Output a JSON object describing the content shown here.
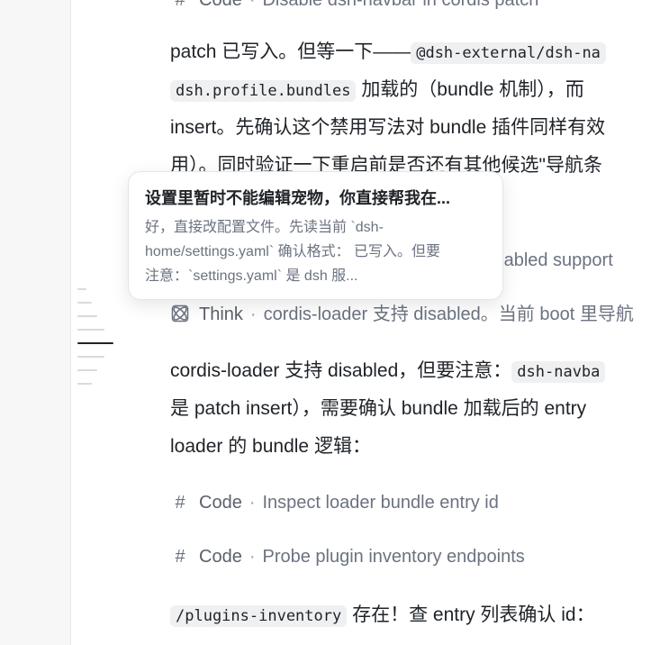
{
  "top_step": {
    "kind": "Code",
    "summary": "Disable dsh-navbar in cordis patch"
  },
  "paragraph1": {
    "l1_text": "patch 已写入。但等一下——",
    "l1_code": "@dsh-external/dsh-na",
    "l2_code": "dsh.profile.bundles",
    "l2_text": "加载的（bundle 机制），而",
    "l3_text": "insert。先确认这个禁用写法对 bundle 插件同样有效",
    "l4_text": "用）。同时验证一下重启前是否还有其他候选\"导航条"
  },
  "hidden_step": {
    "text": "l disabled support"
  },
  "think_step": {
    "kind": "Think",
    "summary": "cordis-loader 支持 disabled。当前 boot 里导航"
  },
  "paragraph2": {
    "l1_text": "cordis-loader 支持 disabled，但要注意：",
    "l1_code": "dsh-navba",
    "l2_text": "是 patch insert），需要确认 bundle 加载后的 entry",
    "l3_text": "loader 的 bundle 逻辑："
  },
  "code_steps": [
    {
      "kind": "Code",
      "summary": "Inspect loader bundle entry id"
    },
    {
      "kind": "Code",
      "summary": "Probe plugin inventory endpoints"
    }
  ],
  "paragraph3": {
    "code": "/plugins-inventory",
    "text": "存在！查 entry 列表确认 id："
  },
  "tooltip": {
    "title": "设置里暂时不能编辑宠物，你直接帮我在...",
    "line1": "好，直接改配置文件。先读当前 `dsh-",
    "line2": "home/settings.yaml` 确认格式： 已写入。但要",
    "line3": "注意：`settings.yaml` 是 dsh 服..."
  },
  "icons": {
    "code": "hash-icon",
    "think": "atom-icon"
  }
}
